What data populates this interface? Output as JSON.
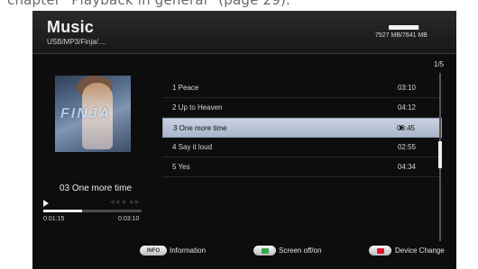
{
  "manual_caption": "chapter \"Playback in general\" (page 29).",
  "header": {
    "title": "Music",
    "path": "USB/MP3/Finja/....",
    "storage_text": "7527 MB/7641 MB",
    "storage_used_fraction": 0.985
  },
  "album_art": {
    "logo": "FINJA"
  },
  "now_playing": {
    "title": "03 One more time",
    "elapsed": "0:01:15",
    "total": "0:03:10",
    "progress_fraction": 0.39
  },
  "track_list": {
    "page": "1/5",
    "tracks": [
      {
        "title": "1 Peace",
        "duration": "03:10",
        "selected": false
      },
      {
        "title": "2 Up to Heaven",
        "duration": "04:12",
        "selected": false
      },
      {
        "title": "3 One more time",
        "duration": "03:45",
        "selected": true
      },
      {
        "title": "4 Say it loud",
        "duration": "02:55",
        "selected": false
      },
      {
        "title": "5 Yes",
        "duration": "04:34",
        "selected": false
      }
    ]
  },
  "footer": {
    "info_button": "INFO",
    "info_label": "Information",
    "green_label": "Screen off/on",
    "red_label": "Device Change",
    "green_color": "#2ea84a",
    "red_color": "#d4142a"
  }
}
